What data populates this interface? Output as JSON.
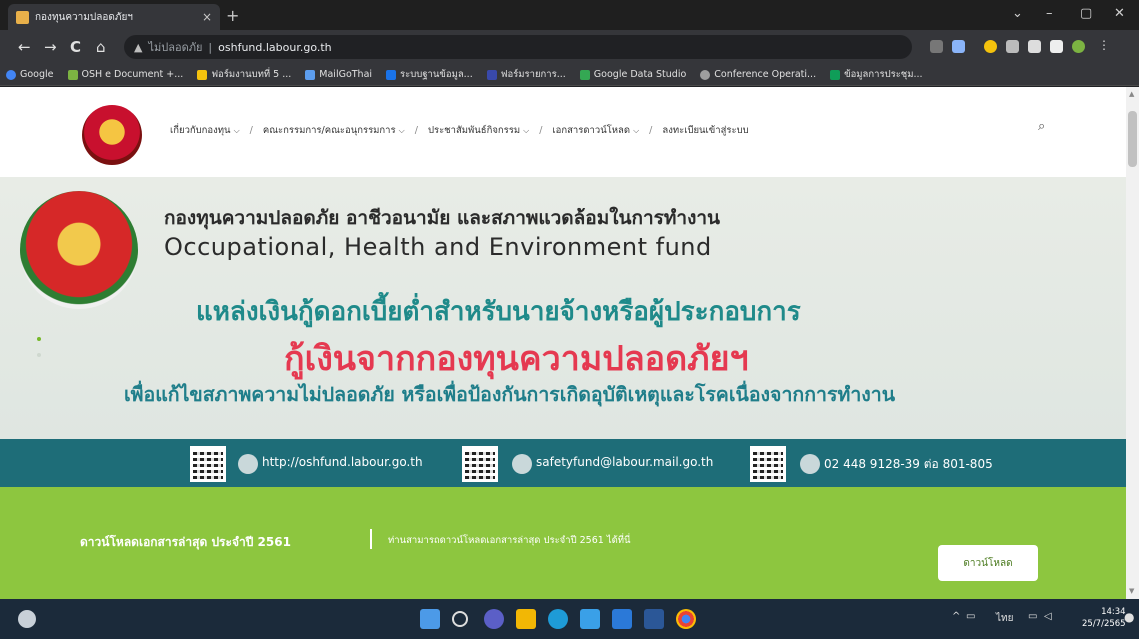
{
  "browser": {
    "tab_title": "กองทุนความปลอดภัยฯ",
    "tab_close": "×",
    "new_tab": "+",
    "window_controls": [
      "⌄",
      "–",
      "▢",
      "✕"
    ],
    "nav": {
      "back": "←",
      "forward": "→",
      "reload": "C",
      "home": "⌂"
    },
    "security_label": "ไม่ปลอดภัย",
    "url": "oshfund.labour.go.th",
    "bookmarks": [
      "Google",
      "OSH e Document +...",
      "ฟอร์มงานบทที่ 5 ...",
      "MailGoThai",
      "ระบบฐานข้อมูล...",
      "ฟอร์มรายการ...",
      "Google Data Studio",
      "Conference Operati...",
      "ข้อมูลการประชุม..."
    ]
  },
  "site": {
    "menu": [
      {
        "label": "เกี่ยวกับกองทุน",
        "has_caret": true
      },
      {
        "label": "คณะกรรมการ/คณะอนุกรรมการ",
        "has_caret": true
      },
      {
        "label": "ประชาสัมพันธ์กิจกรรม",
        "has_caret": true
      },
      {
        "label": "เอกสารดาวน์โหลด",
        "has_caret": true
      },
      {
        "label": "ลงทะเบียนเข้าสู่ระบบ",
        "has_caret": false
      }
    ],
    "search_icon": "⌕"
  },
  "banner": {
    "thai_title": "กองทุนความปลอดภัย อาชีวอนามัย และสภาพแวดล้อมในการทำงาน",
    "en_title": "Occupational, Health and Environment fund",
    "line1": "แหล่งเงินกู้ดอกเบี้ยต่ำสำหรับนายจ้างหรือผู้ประกอบการ",
    "line2": "กู้เงินจากกองทุนความปลอดภัยฯ",
    "line3": "เพื่อแก้ไขสภาพความไม่ปลอดภัย หรือเพื่อป้องกันการเกิดอุบัติเหตุและโรคเนื่องจากการทำงาน",
    "contacts": {
      "website": "http://oshfund.labour.go.th",
      "email": "safetyfund@labour.mail.go.th",
      "phone": "02 448 9128-39 ต่อ 801-805"
    }
  },
  "download": {
    "title": "ดาวน์โหลดเอกสารล่าสุด ประจำปี 2561",
    "desc": "ท่านสามารถดาวน์โหลดเอกสารล่าสุด ประจำปี 2561 ได้ที่นี่",
    "button": "ดาวน์โหลด"
  },
  "taskbar": {
    "tray_lang": "ไทย",
    "time": "14:34",
    "date": "25/7/2565"
  },
  "colors": {
    "banner_teal": "#1f8a8a",
    "banner_red": "#e53950",
    "contact_bar": "#1e6d78",
    "download_green": "#8dc63f"
  }
}
